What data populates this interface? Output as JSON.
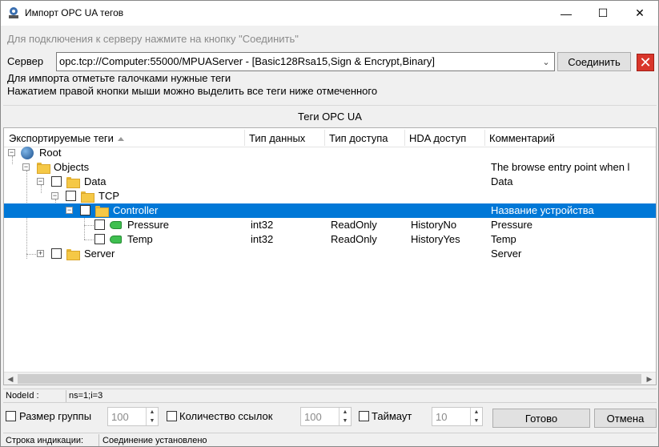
{
  "window": {
    "title": "Импорт OPC UA тегов",
    "minimize": "—",
    "maximize": "☐",
    "close": "✕"
  },
  "connect_hint": "Для подключения к серверу нажмите на кнопку \"Соединить\"",
  "server": {
    "label": "Сервер",
    "value": "opc.tcp://Computer:55000/MPUAServer - [Basic128Rsa15,Sign & Encrypt,Binary]",
    "connect_label": "Соединить"
  },
  "hints": {
    "line1": "Для импорта отметьте галочками нужные теги",
    "line2": "Нажатием правой кнопки мыши можно выделить все теги ниже отмеченного"
  },
  "panel_title": "Теги OPC UA",
  "columns": {
    "name": "Экспортируемые теги",
    "type": "Тип данных",
    "access": "Тип доступа",
    "hda": "HDA доступ",
    "comment": "Комментарий"
  },
  "tree": [
    {
      "name": "Root",
      "type": "",
      "access": "",
      "hda": "",
      "comment": ""
    },
    {
      "name": "Objects",
      "type": "",
      "access": "",
      "hda": "",
      "comment": "The browse entry point when l"
    },
    {
      "name": "Data",
      "type": "",
      "access": "",
      "hda": "",
      "comment": "Data"
    },
    {
      "name": "TCP",
      "type": "",
      "access": "",
      "hda": "",
      "comment": ""
    },
    {
      "name": "Controller",
      "type": "",
      "access": "",
      "hda": "",
      "comment": "Название устройства"
    },
    {
      "name": "Pressure",
      "type": "int32",
      "access": "ReadOnly",
      "hda": "HistoryNo",
      "comment": "Pressure"
    },
    {
      "name": "Temp",
      "type": "int32",
      "access": "ReadOnly",
      "hda": "HistoryYes",
      "comment": "Temp"
    },
    {
      "name": "Server",
      "type": "",
      "access": "",
      "hda": "",
      "comment": "Server"
    }
  ],
  "nodeid": {
    "label": "NodeId :",
    "value": "ns=1;i=3"
  },
  "options": {
    "group_size_label": "Размер группы",
    "group_size_value": "100",
    "ref_count_label": "Количество ссылок",
    "ref_count_value": "100",
    "timeout_label": "Таймаут",
    "timeout_value": "10"
  },
  "buttons": {
    "ok": "Готово",
    "cancel": "Отмена"
  },
  "status": {
    "label": "Строка индикации:",
    "value": "Соединение установлено"
  }
}
